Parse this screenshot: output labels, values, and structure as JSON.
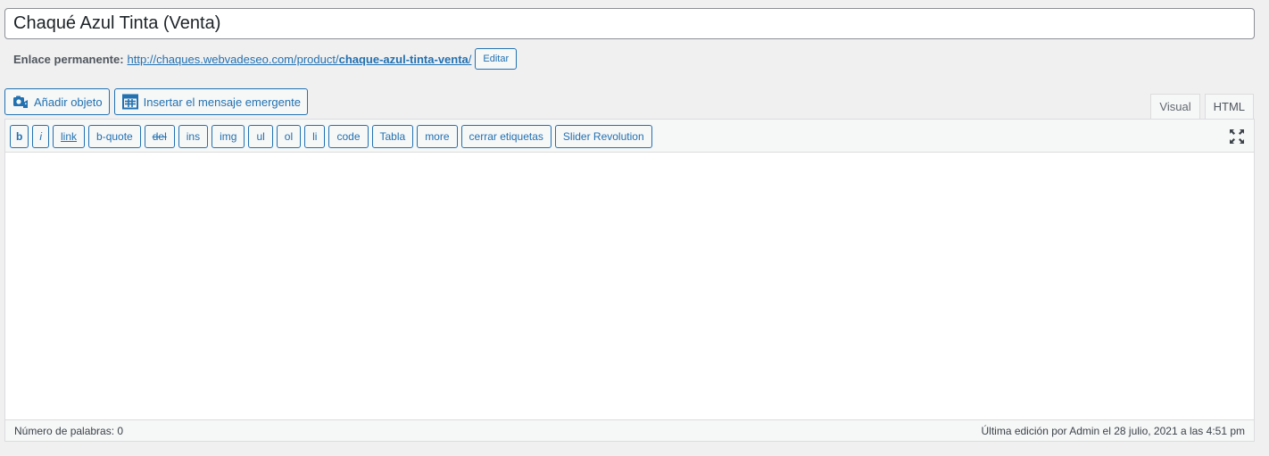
{
  "post": {
    "title": "Chaqué Azul Tinta (Venta)"
  },
  "permalink": {
    "label": "Enlace permanente:",
    "url_prefix": "http://chaques.webvadeseo.com/product/",
    "slug": "chaque-azul-tinta-venta",
    "url_suffix": "/",
    "edit_label": "Editar"
  },
  "media_buttons": {
    "add_media": "Añadir objeto",
    "add_media_icon": "media-camera-icon",
    "insert_popup": "Insertar el mensaje emergente",
    "insert_popup_icon": "popup-table-icon"
  },
  "editor_tabs": {
    "visual": "Visual",
    "html": "HTML",
    "active": "HTML"
  },
  "quicktags": {
    "b": "b",
    "i": "i",
    "link": "link",
    "bquote": "b-quote",
    "del": "del",
    "ins": "ins",
    "img": "img",
    "ul": "ul",
    "ol": "ol",
    "li": "li",
    "code": "code",
    "table": "Tabla",
    "more": "more",
    "close_tags": "cerrar etiquetas",
    "slider": "Slider Revolution",
    "fullscreen_icon": "fullscreen-expand-icon"
  },
  "editor": {
    "content": ""
  },
  "status": {
    "word_count": "Número de palabras: 0",
    "last_edit": "Última edición por Admin el 28 julio, 2021 a las 4:51 pm"
  },
  "colors": {
    "accent": "#2271b1",
    "background": "#f0f0f1",
    "border": "#dcdcde"
  }
}
